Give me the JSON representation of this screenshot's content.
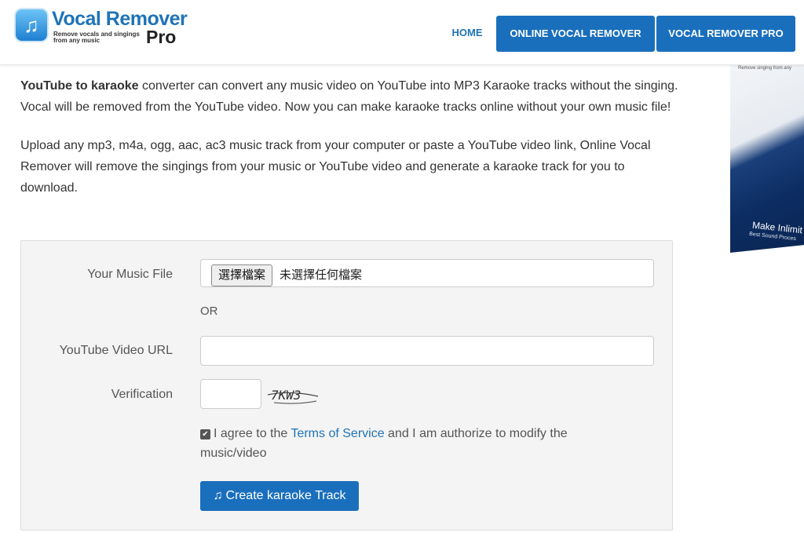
{
  "header": {
    "logo_icon": "music-note-icon",
    "logo_title": "Vocal Remover",
    "logo_subtitle": "Remove vocals and singings from any music",
    "logo_pro": "Pro",
    "nav": {
      "home": "HOME",
      "online": "ONLINE VOCAL REMOVER",
      "pro": "VOCAL REMOVER PRO"
    }
  },
  "promo": {
    "top_text": "Remove singing from any",
    "make_text": "Make Inlimit",
    "best_text": "Best Sound Proces"
  },
  "intro": {
    "bold": "YouTube to karaoke",
    "rest": " converter can convert any music video on YouTube into MP3 Karaoke tracks without the singing. Vocal will be removed from the YouTube video. Now you can make karaoke tracks online without your own music file!",
    "para2": "Upload any mp3, m4a, ogg, aac, ac3 music track from your computer or paste a YouTube video link, Online Vocal Remover will remove the singings from your music or YouTube video and generate a karaoke track for you to download."
  },
  "form": {
    "music_file_label": "Your Music File",
    "file_button": "選擇檔案",
    "file_status": "未選擇任何檔案",
    "or_text": "OR",
    "url_label": "YouTube Video URL",
    "url_value": "",
    "verification_label": "Verification",
    "verification_value": "",
    "captcha_text": "7KW3",
    "agree_checked": true,
    "agree_prefix": "I agree to the ",
    "agree_link": "Terms of Service",
    "agree_suffix": " and I am authorize to modify the music/video",
    "submit_label": "Create karaoke Track",
    "submit_icon": "music-note-icon"
  },
  "colors": {
    "accent": "#1a6fbd",
    "link": "#1f73b7",
    "form_bg": "#f4f4f4"
  }
}
